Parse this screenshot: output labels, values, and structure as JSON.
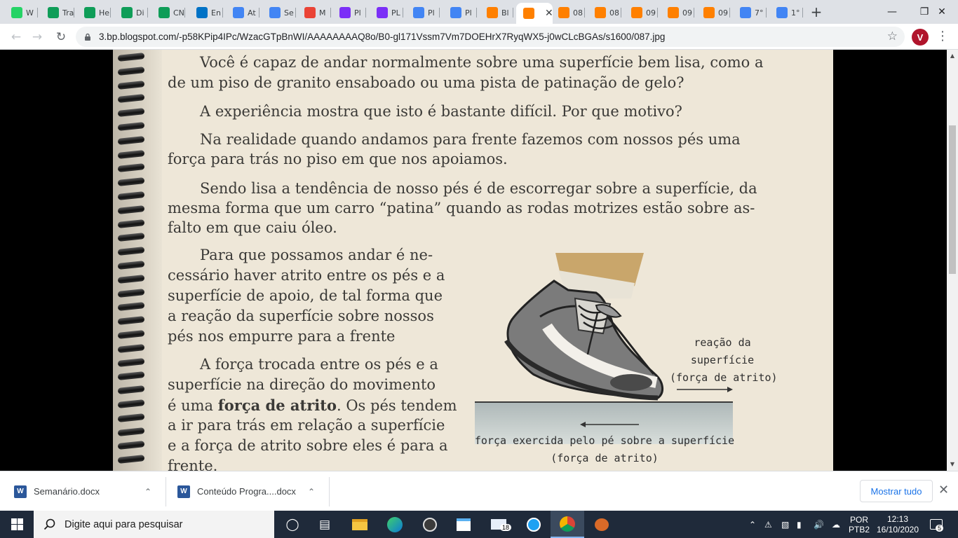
{
  "browser": {
    "tabs": [
      {
        "title": "W",
        "icon": "whatsapp-icon",
        "color": "#25d366"
      },
      {
        "title": "Tra",
        "icon": "sheets-icon",
        "color": "#0f9d58"
      },
      {
        "title": "He",
        "icon": "sheets-icon",
        "color": "#0f9d58"
      },
      {
        "title": "Di",
        "icon": "sheets-icon",
        "color": "#0f9d58"
      },
      {
        "title": "CN",
        "icon": "sheets-icon",
        "color": "#0f9d58"
      },
      {
        "title": "En",
        "icon": "outlook-icon",
        "color": "#0072c6"
      },
      {
        "title": "At",
        "icon": "docs-icon",
        "color": "#4285f4"
      },
      {
        "title": "Se",
        "icon": "translate-icon",
        "color": "#4285f4"
      },
      {
        "title": "M",
        "icon": "gmail-icon",
        "color": "#ea4335"
      },
      {
        "title": "Pl",
        "icon": "app-icon",
        "color": "#7b2ff7"
      },
      {
        "title": "PL",
        "icon": "app-icon",
        "color": "#7b2ff7"
      },
      {
        "title": "Pl",
        "icon": "docs-icon",
        "color": "#4285f4"
      },
      {
        "title": "Pl",
        "icon": "docs-icon",
        "color": "#4285f4"
      },
      {
        "title": "Bl",
        "icon": "blogger-icon",
        "color": "#ff8000"
      },
      {
        "title": "",
        "icon": "blogger-icon",
        "color": "#ff8000",
        "active": true
      },
      {
        "title": "08",
        "icon": "blogger-icon",
        "color": "#ff8000"
      },
      {
        "title": "08",
        "icon": "blogger-icon",
        "color": "#ff8000"
      },
      {
        "title": "09",
        "icon": "blogger-icon",
        "color": "#ff8000"
      },
      {
        "title": "09",
        "icon": "blogger-icon",
        "color": "#ff8000"
      },
      {
        "title": "09",
        "icon": "blogger-icon",
        "color": "#ff8000"
      },
      {
        "title": "7°",
        "icon": "docs-icon",
        "color": "#4285f4"
      },
      {
        "title": "1°",
        "icon": "docs-icon",
        "color": "#4285f4"
      }
    ],
    "new_tab": "+",
    "url": "3.bp.blogspot.com/-p58KPip4IPc/WzacGTpBnWI/AAAAAAAAQ8o/B0-gl171Vssm7Vm7DOEHrX7RyqWX5-j0wCLcBGAs/s1600/087.jpg",
    "avatar_letter": "V"
  },
  "document": {
    "paragraphs": [
      [
        "Você é capaz de andar normalmente sobre uma superfície bem lisa, como a",
        "de um piso de granito ensaboado ou uma pista de patinação de gelo?"
      ],
      [
        "A experiência mostra que isto é  bastante difícil. Por que motivo?"
      ],
      [
        "Na realidade quando andamos para frente fazemos com nossos pés uma",
        "força para trás no piso em que nos apoiamos."
      ],
      [
        "Sendo lisa a tendência de nosso pés é de escorregar sobre a superfície, da",
        "mesma forma que um carro “patina” quando as rodas motrizes estão sobre as-",
        "falto em que caiu óleo."
      ],
      [
        "Para que possamos andar é ne-",
        "cessário haver atrito entre os pés e a",
        "superfície de apoio, de tal forma que",
        "a reação da superfície sobre nossos",
        "pés nos empurre para a frente"
      ]
    ],
    "last_para_lines": [
      "A força trocada entre os pés e a",
      "superfície na direção do movimento"
    ],
    "last_para_bold_prefix": "é uma ",
    "last_para_bold": "força de atrito",
    "last_para_bold_suffix": ". Os pés tendem",
    "last_para_rest": [
      "a ir para trás em relação a superfície",
      "e a força de atrito sobre eles é para a",
      "frente."
    ],
    "diagram": {
      "reaction_label": [
        "reação da",
        "superfície",
        "(força de atrito)"
      ],
      "foot_label": [
        "força exercida pelo pé sobre a superfície",
        "(força de atrito)"
      ]
    }
  },
  "downloads": {
    "items": [
      {
        "name": "Semanário.docx"
      },
      {
        "name": "Conteúdo Progra....docx"
      }
    ],
    "show_all": "Mostrar tudo"
  },
  "taskbar": {
    "search_placeholder": "Digite aqui para pesquisar",
    "mail_badge": "18",
    "lang_top": "POR",
    "lang_bottom": "PTB2",
    "time": "12:13",
    "date": "16/10/2020",
    "notifications": "5"
  }
}
